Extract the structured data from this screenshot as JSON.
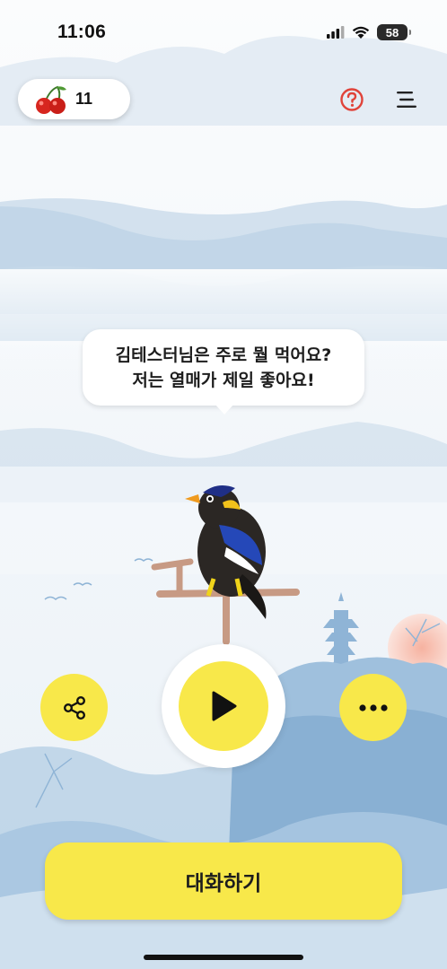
{
  "status_bar": {
    "time": "11:06",
    "battery": "58"
  },
  "header": {
    "cherry_count": "11"
  },
  "speech_bubble": {
    "line1": "김테스터님은 주로 뭘 먹어요?",
    "line2": "저는 열매가 제일 좋아요!"
  },
  "controls": {
    "share_icon": "share-icon",
    "play_icon": "play-icon",
    "more_icon": "more-icon"
  },
  "talk_button": {
    "label": "대화하기"
  },
  "colors": {
    "accent_yellow": "#f8e84a",
    "help_red": "#e0433a",
    "sky": "#eef4f9",
    "mountain_blue": "#9dbfdc"
  }
}
